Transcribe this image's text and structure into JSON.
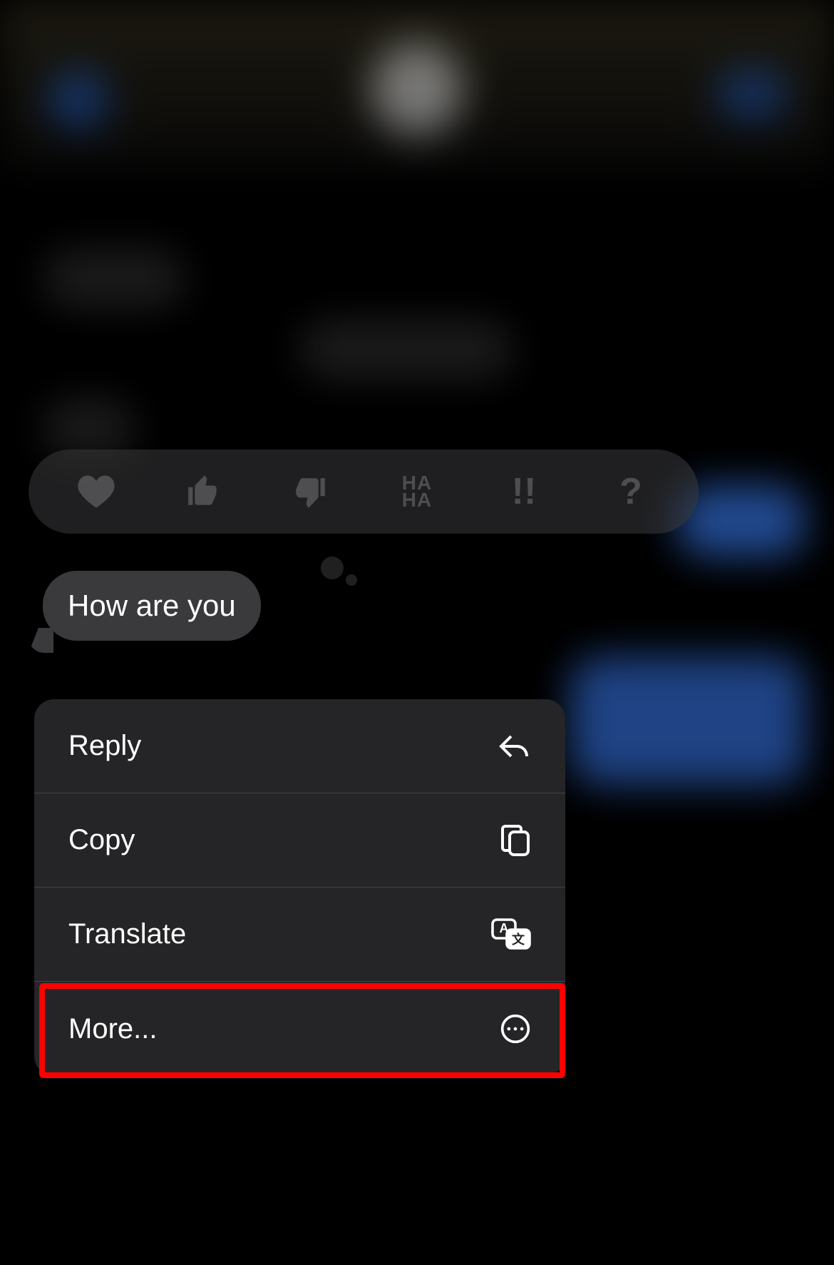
{
  "message": {
    "text": "How are you"
  },
  "reactions": {
    "heart": "heart-icon",
    "thumbsUp": "thumbs-up-icon",
    "thumbsDown": "thumbs-down-icon",
    "haha": "HA\nHA",
    "exclaim": "!!",
    "question": "?"
  },
  "menu": {
    "items": [
      {
        "label": "Reply",
        "icon": "reply-icon"
      },
      {
        "label": "Copy",
        "icon": "copy-icon"
      },
      {
        "label": "Translate",
        "icon": "translate-icon"
      },
      {
        "label": "More...",
        "icon": "more-icon"
      }
    ]
  },
  "annotation": {
    "highlighted_item": "More..."
  }
}
